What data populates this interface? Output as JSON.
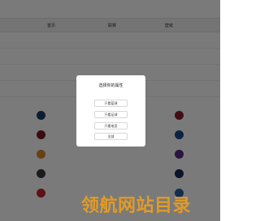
{
  "tabs": [
    "首页",
    "联赛",
    "壁纸"
  ],
  "modal": {
    "title": "选择你的属性",
    "options": [
      "只看篮球",
      "只看足球",
      "只看电竞",
      "全部"
    ]
  },
  "watermark": {
    "text": "领航网站目录",
    "color": "#f2a11a"
  },
  "colors": {
    "overlay": "rgba(0,0,0,0.52)",
    "accent": "#f2a11a"
  }
}
